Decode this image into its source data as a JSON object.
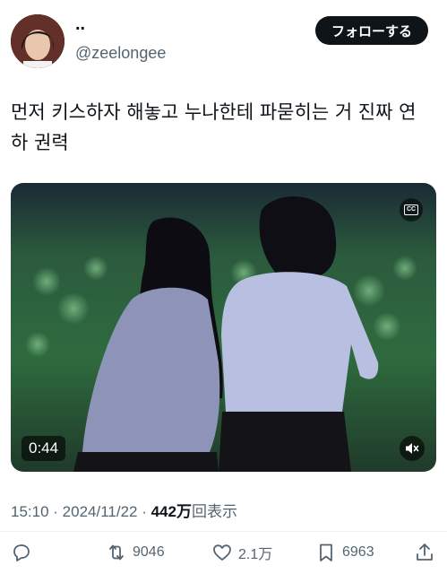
{
  "author": {
    "display_name": "..",
    "handle": "@zeelongee"
  },
  "follow_button_label": "フォローする",
  "tweet_text": "먼저 키스하자 해놓고 누나한테 파묻히는 거 진짜 연\n하 권력",
  "video": {
    "duration": "0:44"
  },
  "meta": {
    "time": "15:10",
    "separator_1": " · ",
    "date": "2024/11/22",
    "separator_2": " · ",
    "views_count": "442万",
    "views_label": "回表示"
  },
  "actions": {
    "retweets": "9046",
    "likes": "2.1万",
    "bookmarks": "6963"
  },
  "icons": {
    "reply": "reply-icon",
    "retweet": "retweet-icon",
    "like": "heart-icon",
    "bookmark": "bookmark-icon",
    "share": "share-icon",
    "cc": "closed-captions-icon",
    "mute": "muted-speaker-icon"
  },
  "colors": {
    "text_primary": "#0f1419",
    "text_secondary": "#536471",
    "follow_bg": "#0f1419"
  }
}
